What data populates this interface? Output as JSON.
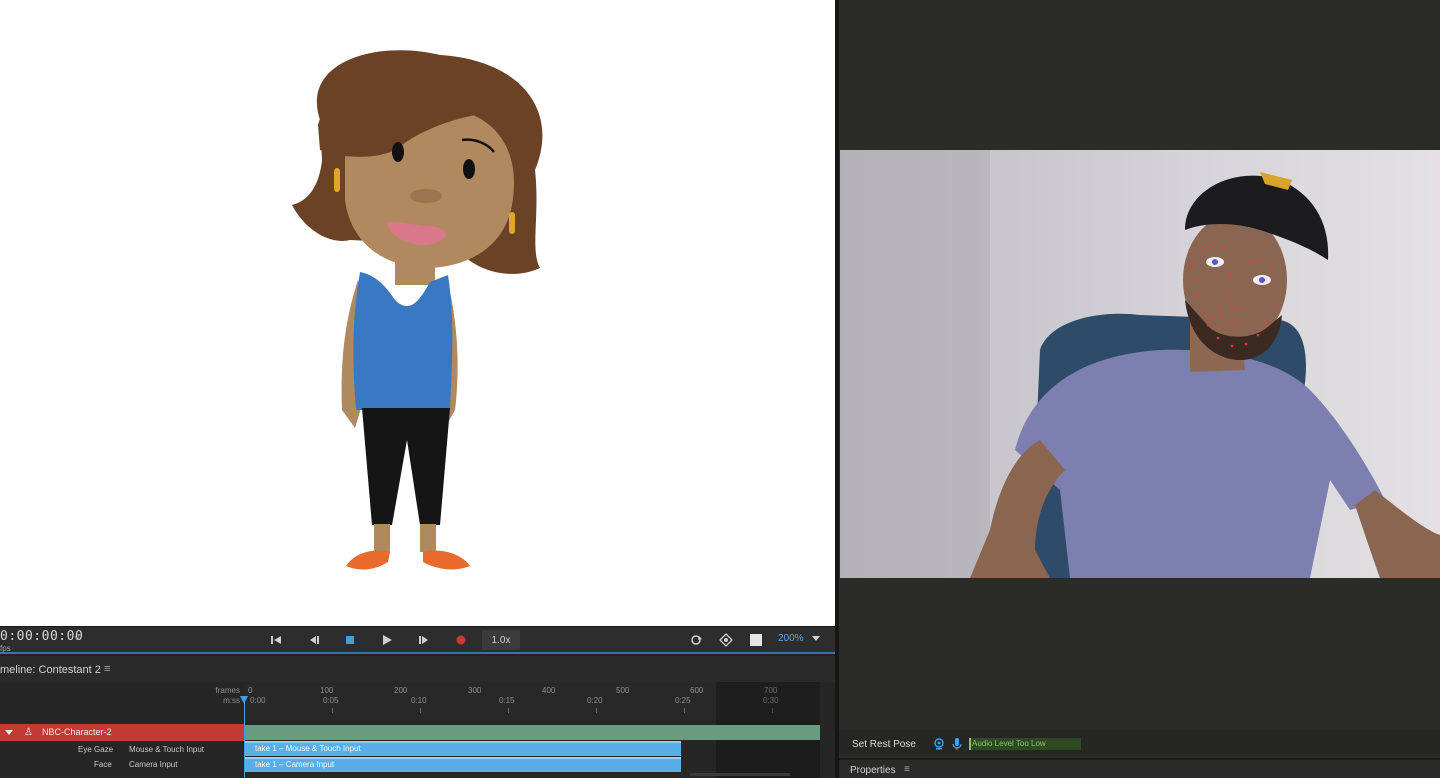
{
  "transport": {
    "timecode": "0:00:00:00",
    "timecode_frames": "0",
    "fps_label": "fps",
    "speed": "1.0x",
    "zoom": "200%"
  },
  "timeline": {
    "title": "meline: Contestant 2",
    "menu_icon": "≡",
    "ruler": {
      "frames_label": "frames",
      "time_label": "m:ss",
      "frame_ticks": [
        "0",
        "100",
        "200",
        "300",
        "400",
        "500",
        "600",
        "700"
      ],
      "time_ticks": [
        "0:00",
        "0:05",
        "0:10",
        "0:15",
        "0:20",
        "0:25",
        "0:30"
      ]
    },
    "character_row": {
      "name": "NBC-Character-2",
      "icon": "puppet-icon"
    },
    "behaviors": [
      {
        "name": "Eye Gaze",
        "input": "Mouse & Touch Input",
        "take": "take 1 – Mouse & Touch Input"
      },
      {
        "name": "Face",
        "input": "Camera Input",
        "take": "take 1 – Camera Input"
      }
    ]
  },
  "camera_panel": {
    "set_rest_pose": "Set Rest Pose",
    "audio_status": "Audio Level Too Low",
    "camera_icon": "webcam-icon",
    "mic_icon": "microphone-icon"
  },
  "properties_panel": {
    "title": "Properties",
    "menu_icon": "≡"
  },
  "colors": {
    "accent": "#2f76b7",
    "character_row": "#c23a33",
    "take_track": "#5aaee8",
    "green_track": "#6a9b7d",
    "audio_text": "#8cc06a"
  }
}
